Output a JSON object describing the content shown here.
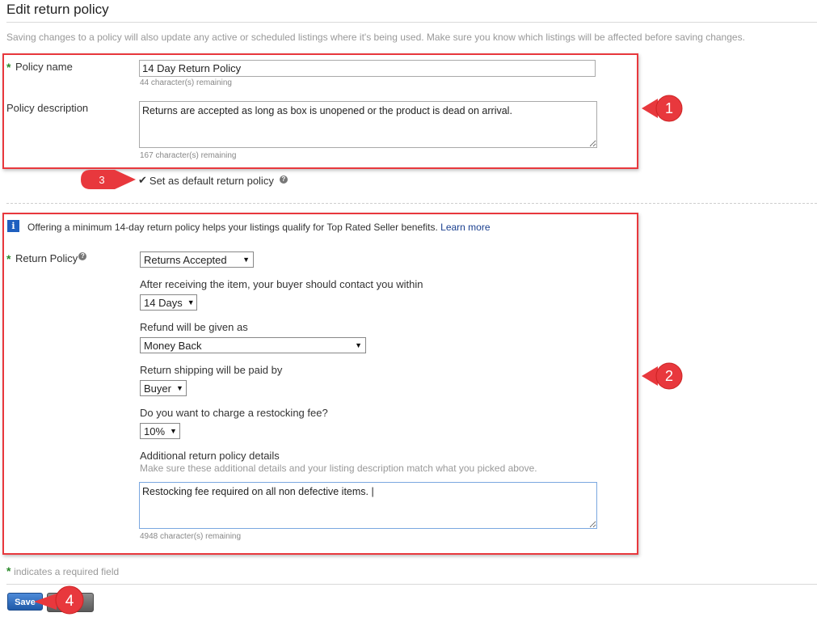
{
  "page": {
    "title": "Edit return policy",
    "notice": "Saving changes to a policy will also update any active or scheduled listings where it's being used. Make sure you know which listings will be affected before saving changes."
  },
  "policy": {
    "name_label": "Policy name",
    "name_value": "14 Day Return Policy",
    "name_remaining": "44 character(s) remaining",
    "desc_label": "Policy description",
    "desc_value": "Returns are accepted as long as box is unopened or the product is dead on arrival.",
    "desc_remaining": "167 character(s) remaining",
    "default_check": "✔",
    "default_label": "Set as default return policy",
    "help_icon": "?"
  },
  "returns": {
    "info_icon": "i",
    "info_text": "Offering a minimum 14-day return policy helps your listings qualify for Top Rated Seller benefits.",
    "learn_more": "Learn more",
    "policy_label": "Return Policy",
    "policy_value": "Returns Accepted",
    "contact_label": "After receiving the item, your buyer should contact you within",
    "contact_value": "14 Days",
    "refund_label": "Refund will be given as",
    "refund_value": "Money Back",
    "shipping_label": "Return shipping will be paid by",
    "shipping_value": "Buyer",
    "fee_label": "Do you want to charge a restocking fee?",
    "fee_value": "10%",
    "details_label": "Additional return policy details",
    "details_hint": "Make sure these additional details and your listing description match what you picked above.",
    "details_value": "Restocking fee required on all non defective items. |",
    "details_remaining": "4948 character(s) remaining"
  },
  "footer": {
    "required_star": "*",
    "required_text": "indicates a required field",
    "save_label": "Save"
  },
  "callouts": [
    "1",
    "2",
    "3",
    "4"
  ],
  "colors": {
    "highlight_red": "#e8383d",
    "required_green": "#2a8a2a",
    "save_blue": "#2a6bc0",
    "info_blue": "#1f5fbf",
    "link_blue": "#1a3f8f"
  }
}
